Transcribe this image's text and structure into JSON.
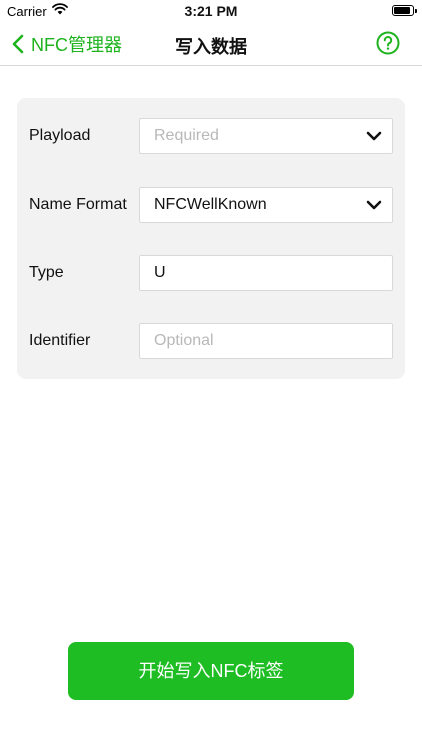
{
  "status_bar": {
    "carrier": "Carrier",
    "time": "3:21 PM"
  },
  "nav": {
    "back_label": "NFC管理器",
    "title": "写入数据",
    "accent_color": "#1db31d"
  },
  "form": {
    "rows": [
      {
        "label": "Playload",
        "placeholder": "Required",
        "value": "",
        "kind": "select"
      },
      {
        "label": "Name Format",
        "placeholder": "",
        "value": "NFCWellKnown",
        "kind": "select"
      },
      {
        "label": "Type",
        "placeholder": "",
        "value": "U",
        "kind": "input"
      },
      {
        "label": "Identifier",
        "placeholder": "Optional",
        "value": "",
        "kind": "input"
      }
    ]
  },
  "action": {
    "start_label": "开始写入NFC标签",
    "color": "#1ebd24"
  }
}
